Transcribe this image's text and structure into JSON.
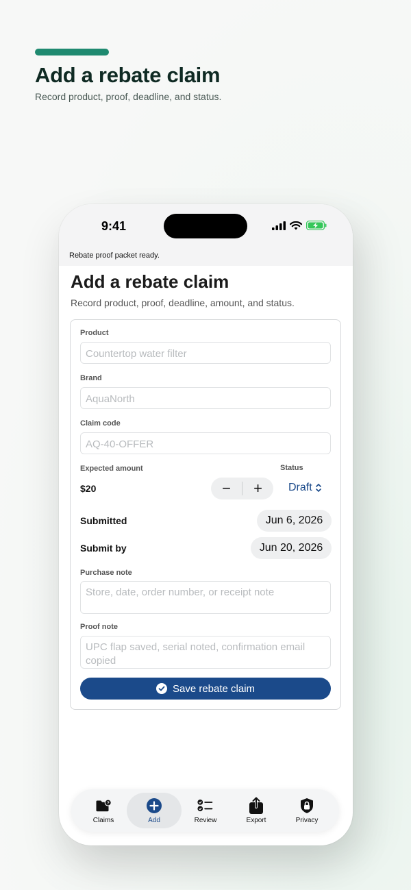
{
  "hero": {
    "title": "Add a rebate claim",
    "subtitle": "Record product, proof, deadline, and status."
  },
  "colors": {
    "accent": "#1f8a70",
    "primary": "#1b4a8a",
    "battery": "#34c759"
  },
  "status_bar": {
    "time": "9:41",
    "icons": [
      "signal-icon",
      "wifi-icon",
      "battery-charging-icon"
    ]
  },
  "toast": "Rebate proof packet ready.",
  "page": {
    "title": "Add a rebate claim",
    "subtitle": "Record product, proof, deadline, amount, and status."
  },
  "form": {
    "product": {
      "label": "Product",
      "placeholder": "Countertop water filter"
    },
    "brand": {
      "label": "Brand",
      "placeholder": "AquaNorth"
    },
    "claim_code": {
      "label": "Claim code",
      "placeholder": "AQ-40-OFFER"
    },
    "expected_amount": {
      "label": "Expected amount",
      "value": "$20",
      "decrement": "−",
      "increment": "+"
    },
    "status": {
      "label": "Status",
      "value": "Draft"
    },
    "submitted": {
      "label": "Submitted",
      "value": "Jun 6, 2026"
    },
    "submit_by": {
      "label": "Submit by",
      "value": "Jun 20, 2026"
    },
    "purchase_note": {
      "label": "Purchase note",
      "placeholder": "Store, date, order number, or receipt note"
    },
    "proof_note": {
      "label": "Proof note",
      "placeholder": "UPC flap saved, serial noted, confirmation email copied"
    },
    "save_label": "Save rebate claim"
  },
  "tabs": [
    {
      "label": "Claims",
      "icon": "folder-badge-icon",
      "active": false
    },
    {
      "label": "Add",
      "icon": "plus-circle-icon",
      "active": true
    },
    {
      "label": "Review",
      "icon": "checklist-icon",
      "active": false
    },
    {
      "label": "Export",
      "icon": "share-icon",
      "active": false
    },
    {
      "label": "Privacy",
      "icon": "lock-shield-icon",
      "active": false
    }
  ]
}
